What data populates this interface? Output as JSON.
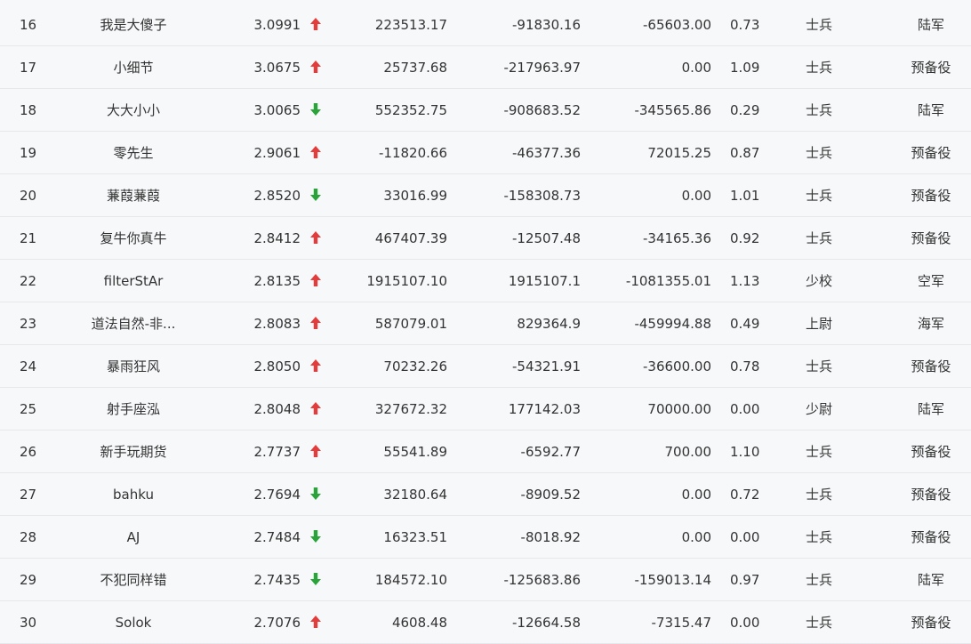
{
  "colors": {
    "up": "#e23c3c",
    "down": "#29a33a",
    "text": "#333333",
    "background": "#f7f8fa",
    "divider": "#e6e8eb"
  },
  "rows": [
    {
      "rank": "16",
      "name": "我是大傻子",
      "score": "3.0991",
      "trend": "up",
      "v1": "223513.17",
      "v2": "-91830.16",
      "v3": "-65603.00",
      "ratio": "0.73",
      "level": "士兵",
      "branch": "陆军"
    },
    {
      "rank": "17",
      "name": "小细节",
      "score": "3.0675",
      "trend": "up",
      "v1": "25737.68",
      "v2": "-217963.97",
      "v3": "0.00",
      "ratio": "1.09",
      "level": "士兵",
      "branch": "预备役"
    },
    {
      "rank": "18",
      "name": "大大小小",
      "score": "3.0065",
      "trend": "down",
      "v1": "552352.75",
      "v2": "-908683.52",
      "v3": "-345565.86",
      "ratio": "0.29",
      "level": "士兵",
      "branch": "陆军"
    },
    {
      "rank": "19",
      "name": "零先生",
      "score": "2.9061",
      "trend": "up",
      "v1": "-11820.66",
      "v2": "-46377.36",
      "v3": "72015.25",
      "ratio": "0.87",
      "level": "士兵",
      "branch": "预备役"
    },
    {
      "rank": "20",
      "name": "蒹葭蒹葭",
      "score": "2.8520",
      "trend": "down",
      "v1": "33016.99",
      "v2": "-158308.73",
      "v3": "0.00",
      "ratio": "1.01",
      "level": "士兵",
      "branch": "预备役"
    },
    {
      "rank": "21",
      "name": "复牛你真牛",
      "score": "2.8412",
      "trend": "up",
      "v1": "467407.39",
      "v2": "-12507.48",
      "v3": "-34165.36",
      "ratio": "0.92",
      "level": "士兵",
      "branch": "预备役"
    },
    {
      "rank": "22",
      "name": "filterStAr",
      "score": "2.8135",
      "trend": "up",
      "v1": "1915107.10",
      "v2": "1915107.1",
      "v3": "-1081355.01",
      "ratio": "1.13",
      "level": "少校",
      "branch": "空军"
    },
    {
      "rank": "23",
      "name": "道法自然-非...",
      "score": "2.8083",
      "trend": "up",
      "v1": "587079.01",
      "v2": "829364.9",
      "v3": "-459994.88",
      "ratio": "0.49",
      "level": "上尉",
      "branch": "海军"
    },
    {
      "rank": "24",
      "name": "暴雨狂风",
      "score": "2.8050",
      "trend": "up",
      "v1": "70232.26",
      "v2": "-54321.91",
      "v3": "-36600.00",
      "ratio": "0.78",
      "level": "士兵",
      "branch": "预备役"
    },
    {
      "rank": "25",
      "name": "射手座泓",
      "score": "2.8048",
      "trend": "up",
      "v1": "327672.32",
      "v2": "177142.03",
      "v3": "70000.00",
      "ratio": "0.00",
      "level": "少尉",
      "branch": "陆军"
    },
    {
      "rank": "26",
      "name": "新手玩期货",
      "score": "2.7737",
      "trend": "up",
      "v1": "55541.89",
      "v2": "-6592.77",
      "v3": "700.00",
      "ratio": "1.10",
      "level": "士兵",
      "branch": "预备役"
    },
    {
      "rank": "27",
      "name": "bahku",
      "score": "2.7694",
      "trend": "down",
      "v1": "32180.64",
      "v2": "-8909.52",
      "v3": "0.00",
      "ratio": "0.72",
      "level": "士兵",
      "branch": "预备役"
    },
    {
      "rank": "28",
      "name": "AJ",
      "score": "2.7484",
      "trend": "down",
      "v1": "16323.51",
      "v2": "-8018.92",
      "v3": "0.00",
      "ratio": "0.00",
      "level": "士兵",
      "branch": "预备役"
    },
    {
      "rank": "29",
      "name": "不犯同样错",
      "score": "2.7435",
      "trend": "down",
      "v1": "184572.10",
      "v2": "-125683.86",
      "v3": "-159013.14",
      "ratio": "0.97",
      "level": "士兵",
      "branch": "陆军"
    },
    {
      "rank": "30",
      "name": "Solok",
      "score": "2.7076",
      "trend": "up",
      "v1": "4608.48",
      "v2": "-12664.58",
      "v3": "-7315.47",
      "ratio": "0.00",
      "level": "士兵",
      "branch": "预备役"
    }
  ]
}
